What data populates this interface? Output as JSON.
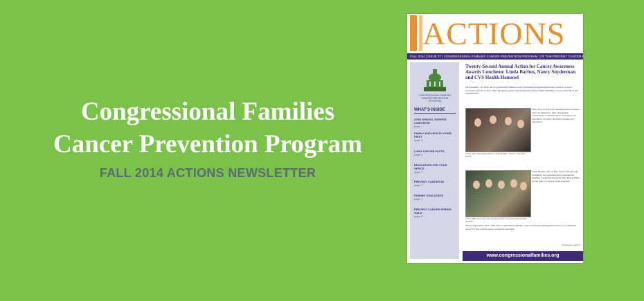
{
  "banner": {
    "headline_line1": "Congressional Families",
    "headline_line2": "Cancer Prevention Program",
    "subheading": "FALL 2014 ACTIONS NEWSLETTER",
    "colors": {
      "background": "#7bc24a",
      "headline": "#ffffff",
      "subheading": "#5b6b73"
    }
  },
  "newsletter": {
    "masthead": "ACTIONS",
    "issue_bar": "FALL 2014  |  ISSUE 37  |  CONGRESSIONAL FAMILIES CANCER PREVENTION PROGRAM  |  OF THE PREVENT CANCER FOUNDATION",
    "sidebar": {
      "logo_text": "CONGRESSIONAL FAMILIES CANCER PREVENTION PROGRAM",
      "whats_inside_title": "WHAT'S INSIDE",
      "items": [
        {
          "label": "22ND ANNUAL AWARDS LUNCHEON",
          "page": "page 1"
        },
        {
          "label": "FAMILY AND HEALTH COME FIRST",
          "page": "page 3"
        },
        {
          "label": "LUNG CANCER FACTS",
          "page": "page 3"
        },
        {
          "label": "RESOURCES FOR YOUR OFFICE",
          "page": "page 7"
        },
        {
          "label": "PREVENT CANCER 5K",
          "page": "page 7"
        },
        {
          "label": "DOMINO CHALLENGE",
          "page": "page 7"
        },
        {
          "label": "PREVENT CANCER SPRING GALA",
          "page": "page 8"
        }
      ]
    },
    "article": {
      "title": "Twenty-Second Annual Action for Cancer Awareness Awards Luncheon: Linda Barbus, Nancy Snyderman and CVS Health Honored",
      "lede": "On September 18, 2014, the Congressional Families Cancer Prevention Program hosted the Action for Cancer Awareness luncheon. More than 350 guests gathered in the Rayburn House Office Building to honor individuals and organizations.",
      "photo1_caption": "Left to right: Kay Curtis Marcus, Linda Barbus, Nancy Lowey and guests",
      "photo2_caption": "Left to right: honorees and members of the Congressional Families program",
      "side_text_1": "This year's Action for Leadership Award winners were recognized for their outstanding contributions to the education, awareness and prevention of cancer through programs and legislation.",
      "side_text_2": "Linda Barbus, wife of Rep. Spencer Bachus (R-Alabama), was presented the Congressional Families Leadership Award by Sen. Richard Burr for her years of service to the program.",
      "bottom_text": "Nancy Snyderman, M.D., NBC News Chief Medical Editor, was awarded the Distinguished Service in Journalism Award for her work in cancer awareness reporting.",
      "continued": "continued on page 2"
    },
    "footer_url": "www.congressionalfamilies.org"
  }
}
